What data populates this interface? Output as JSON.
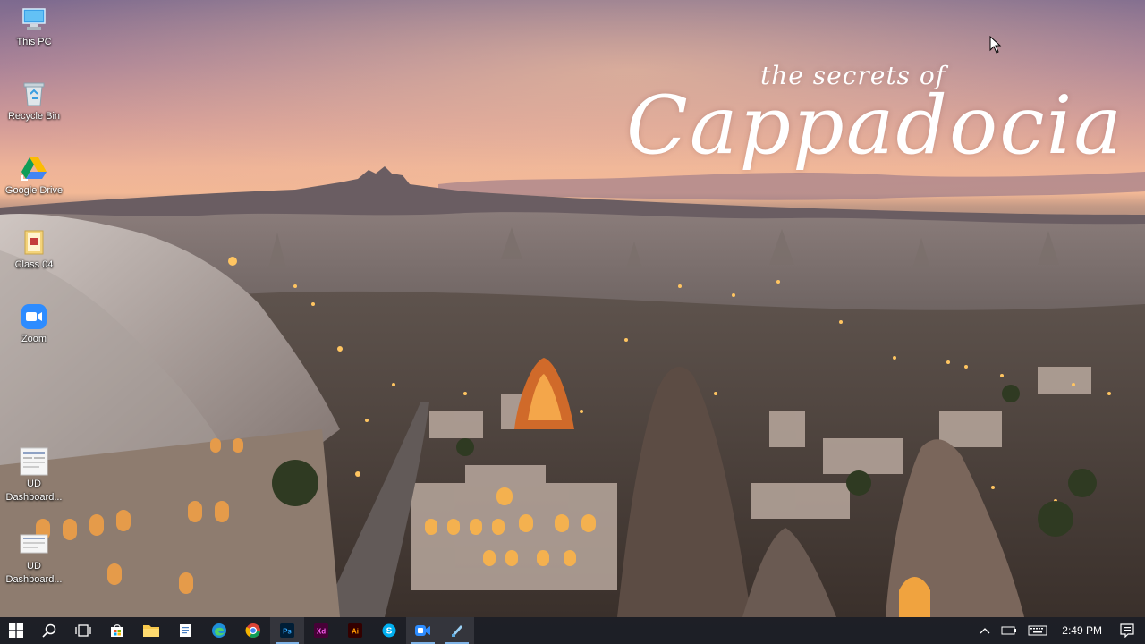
{
  "desktop": {
    "wallpaper": {
      "title_small": "the secrets of",
      "title_big": "Cappadocia"
    },
    "icons": [
      {
        "label": "This PC",
        "icon": "computer-icon"
      },
      {
        "label": "Recycle Bin",
        "icon": "recycle-bin-icon"
      },
      {
        "label": "Google Drive",
        "icon": "google-drive-icon"
      },
      {
        "label": "Class 04",
        "icon": "folder-icon"
      },
      {
        "label": "Zoom",
        "icon": "zoom-icon"
      },
      {
        "label": "UD Dashboard...",
        "icon": "document-icon"
      },
      {
        "label": "UD Dashboard...",
        "icon": "document-icon"
      }
    ]
  },
  "taskbar": {
    "apps": [
      {
        "name": "start",
        "icon": "windows-logo-icon"
      },
      {
        "name": "search",
        "icon": "search-icon"
      },
      {
        "name": "task-view",
        "icon": "task-view-icon"
      },
      {
        "name": "store",
        "icon": "store-icon"
      },
      {
        "name": "file-explorer",
        "icon": "folder-icon"
      },
      {
        "name": "notepad",
        "icon": "notepad-icon"
      },
      {
        "name": "edge",
        "icon": "edge-icon"
      },
      {
        "name": "chrome",
        "icon": "chrome-icon"
      },
      {
        "name": "photoshop",
        "icon": "photoshop-icon",
        "text": "Ps"
      },
      {
        "name": "adobe-xd",
        "icon": "xd-icon",
        "text": "Xd"
      },
      {
        "name": "illustrator",
        "icon": "illustrator-icon",
        "text": "Ai"
      },
      {
        "name": "skype",
        "icon": "skype-icon",
        "text": "S"
      },
      {
        "name": "zoom",
        "icon": "zoom-icon"
      },
      {
        "name": "snip-tool",
        "icon": "snip-icon"
      }
    ],
    "clock": "2:49 PM",
    "colors": {
      "accent": "#7fb3e6",
      "photoshop": "#31a8ff",
      "xd": "#ff61f6",
      "illustrator": "#ff9a00",
      "skype": "#00aff0",
      "zoom": "#2d8cff"
    }
  }
}
